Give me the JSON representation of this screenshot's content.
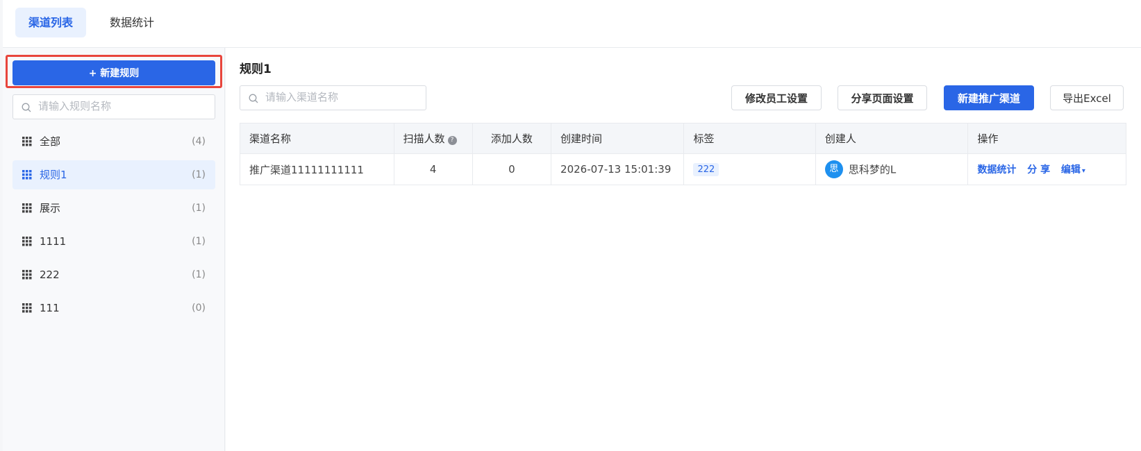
{
  "tabs": [
    {
      "label": "渠道列表",
      "active": true
    },
    {
      "label": "数据统计",
      "active": false
    }
  ],
  "sidebar": {
    "new_rule_label": "+ 新建规则",
    "search_placeholder": "请输入规则名称",
    "items": [
      {
        "name": "全部",
        "count": "(4)",
        "active": false
      },
      {
        "name": "规则1",
        "count": "(1)",
        "active": true
      },
      {
        "name": "展示",
        "count": "(1)",
        "active": false
      },
      {
        "name": "1111",
        "count": "(1)",
        "active": false
      },
      {
        "name": "222",
        "count": "(1)",
        "active": false
      },
      {
        "name": "111",
        "count": "(0)",
        "active": false
      }
    ]
  },
  "main": {
    "title": "规则1",
    "search_placeholder": "请输入渠道名称",
    "buttons": {
      "staff_settings": "修改员工设置",
      "share_settings": "分享页面设置",
      "new_channel": "新建推广渠道",
      "export": "导出Excel"
    },
    "table": {
      "headers": {
        "name": "渠道名称",
        "scans": "扫描人数",
        "adds": "添加人数",
        "created": "创建时间",
        "tags": "标签",
        "creator": "创建人",
        "actions": "操作"
      },
      "help_glyph": "?",
      "rows": [
        {
          "name": "推广渠道11111111111",
          "scans": "4",
          "adds": "0",
          "created": "2026-07-13 15:01:39",
          "tag": "222",
          "avatar": "思",
          "creator": "思科梦的L",
          "actions": {
            "stats": "数据统计",
            "share": "分 享",
            "edit": "编辑",
            "caret": "▾"
          }
        }
      ]
    }
  },
  "colors": {
    "accent": "#2a66e6",
    "highlight": "#e8453c",
    "avatar": "#1e90ef"
  }
}
